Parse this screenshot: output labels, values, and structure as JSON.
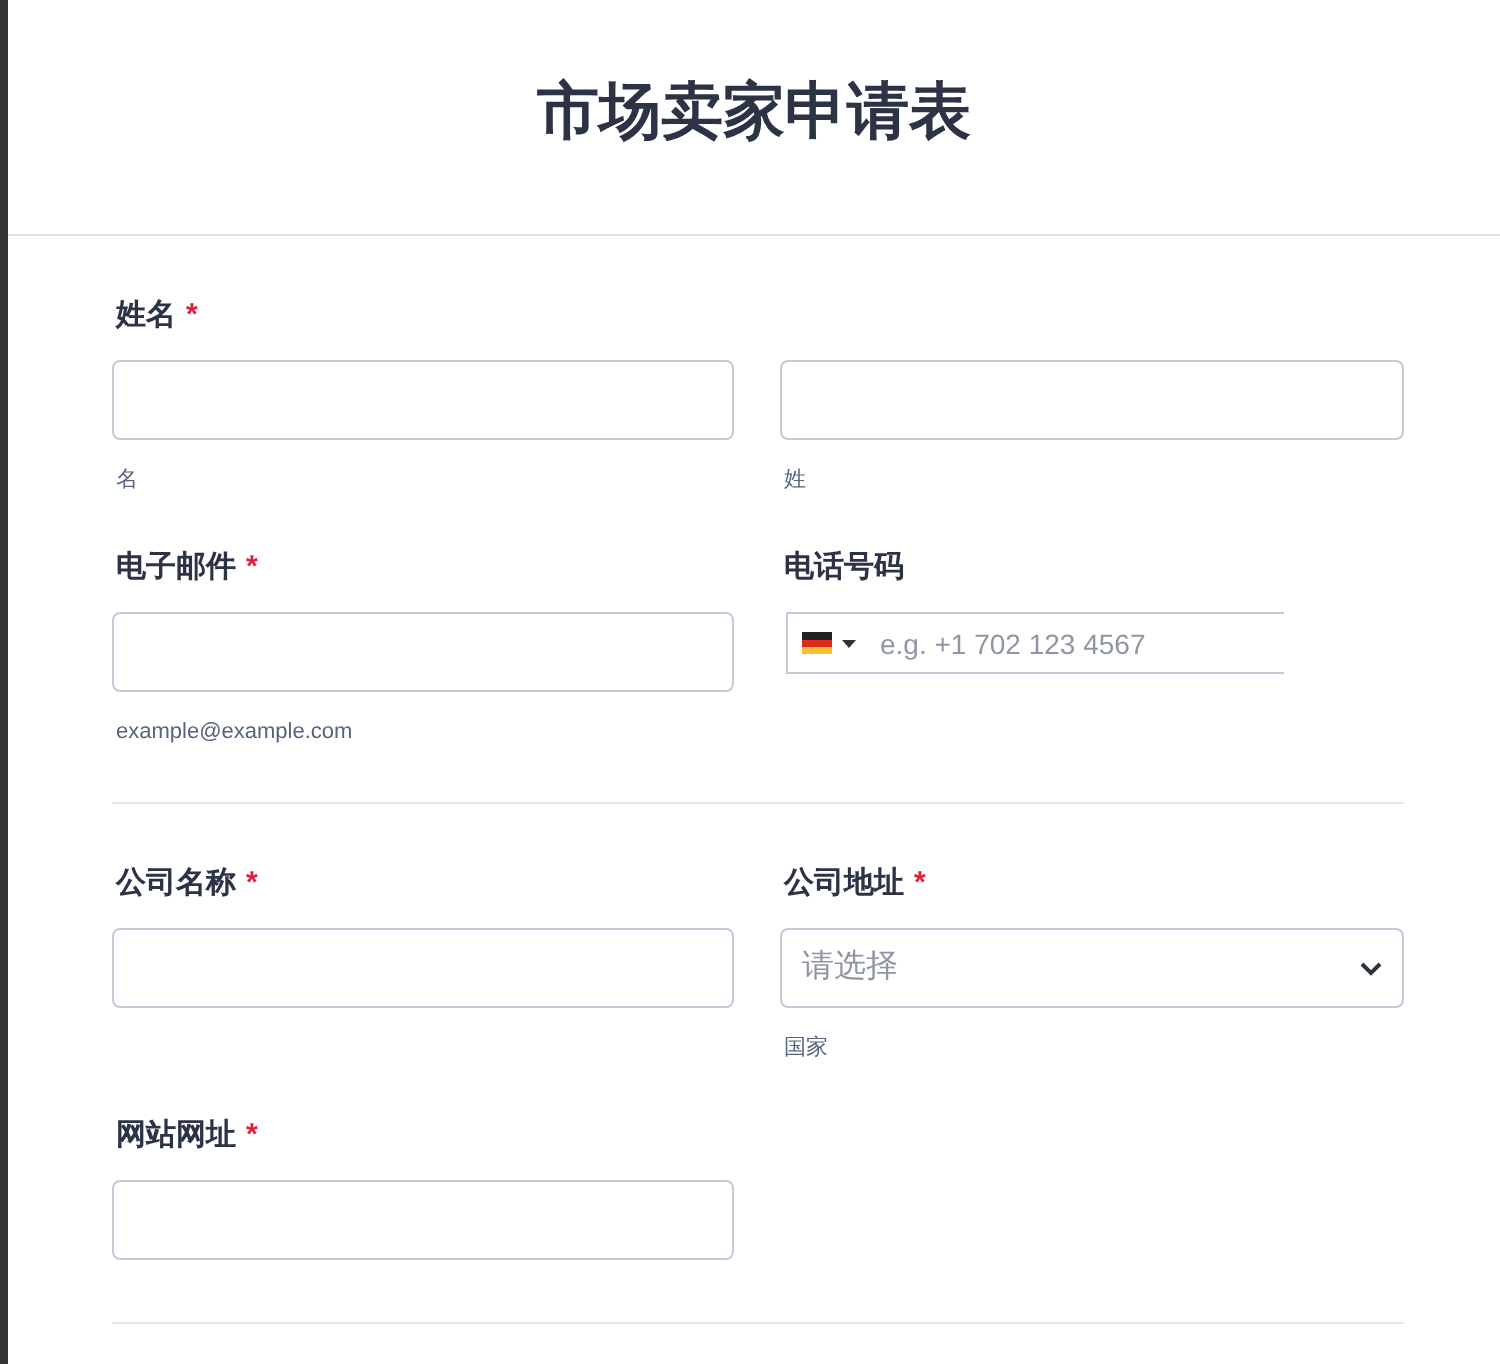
{
  "title": "市场卖家申请表",
  "sections": [
    {
      "rows": [
        [
          {
            "kind": "text",
            "label": "姓名",
            "required_mark": "*",
            "sublabel": "名"
          },
          {
            "kind": "text",
            "sublabel": "姓"
          }
        ],
        [
          {
            "kind": "text",
            "label": "电子邮件",
            "required_mark": "*",
            "sublabel": "example@example.com"
          },
          {
            "kind": "phone",
            "label": "电话号码",
            "placeholder": "e.g. +1 702 123 4567"
          }
        ]
      ]
    },
    {
      "rows": [
        [
          {
            "kind": "text",
            "label": "公司名称",
            "required_mark": "*"
          },
          {
            "kind": "select",
            "label": "公司地址",
            "required_mark": "*",
            "placeholder": "请选择",
            "sublabel": "国家"
          }
        ],
        [
          {
            "kind": "text",
            "label": "网站网址",
            "required_mark": "*"
          }
        ]
      ]
    }
  ]
}
